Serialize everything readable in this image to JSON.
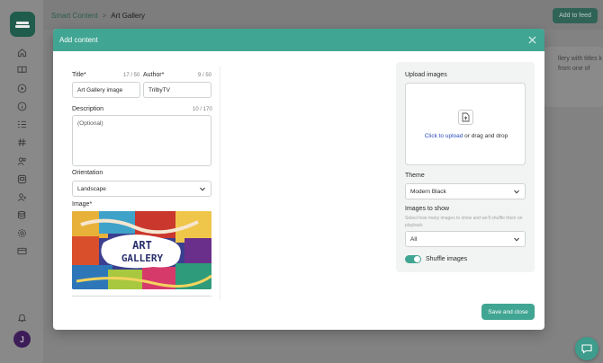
{
  "breadcrumb": {
    "parent": "Smart Content",
    "separator": ">",
    "current": "Art Gallery"
  },
  "header": {
    "add_to_feed_label": "Add to feed"
  },
  "background_card": {
    "text": "llery with titles k from one of"
  },
  "sidebar": {
    "items": [
      {
        "icon": "home-icon"
      },
      {
        "icon": "book-icon"
      },
      {
        "icon": "play-icon"
      },
      {
        "icon": "info-icon"
      },
      {
        "icon": "list-icon"
      },
      {
        "icon": "hashtag-icon"
      },
      {
        "icon": "users-icon"
      },
      {
        "icon": "monitor-icon"
      },
      {
        "icon": "user-add-icon"
      },
      {
        "icon": "database-icon"
      },
      {
        "icon": "gear-icon"
      },
      {
        "icon": "card-icon"
      }
    ],
    "bell_icon": "bell-icon",
    "avatar_initial": "J"
  },
  "modal": {
    "title": "Add content",
    "title_field": {
      "label": "Title",
      "required_mark": "*",
      "counter": "17 / 50",
      "value": "Art Gallery image"
    },
    "author_field": {
      "label": "Author",
      "required_mark": "*",
      "counter": "9 / 50",
      "value": "TrilbyTV"
    },
    "description_field": {
      "label": "Description",
      "counter": "10 / 170",
      "placeholder": "(Optional)"
    },
    "orientation": {
      "label": "Orientation",
      "value": "Landscape"
    },
    "image": {
      "label": "Image",
      "required_mark": "*",
      "art_text_line1": "ART",
      "art_text_line2": "GALLERY"
    },
    "upload": {
      "label": "Upload images",
      "link_text": "Click to upload",
      "rest_text": " or drag and drop"
    },
    "theme": {
      "label": "Theme",
      "value": "Modern Black"
    },
    "images_to_show": {
      "label": "Images to show",
      "help": "Select how many images to show and we'll shuffle them on playback",
      "value": "All"
    },
    "shuffle": {
      "label": "Shuffle images",
      "enabled": true
    },
    "save_label": "Save and close"
  },
  "colors": {
    "accent": "#41a593",
    "brand_dark": "#1f5c4b",
    "link": "#2b4bc0"
  }
}
